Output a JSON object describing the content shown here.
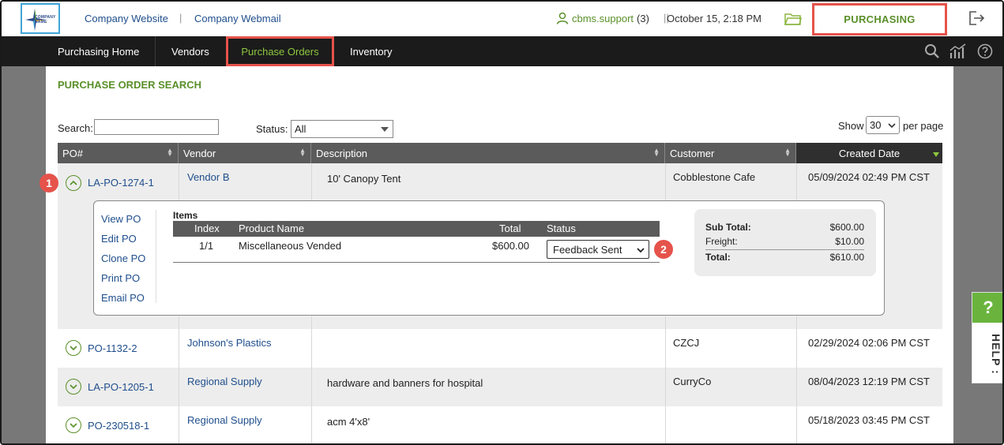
{
  "header": {
    "logo_text": "COMPANY NAME",
    "links": [
      "Company Website",
      "Company Webmail"
    ],
    "user": "cbms.support",
    "user_count": "(3)",
    "datetime": "October 15, 2:18 PM",
    "module": "PURCHASING"
  },
  "nav": {
    "items": [
      "Purchasing Home",
      "Vendors",
      "Purchase Orders",
      "Inventory"
    ],
    "active": "Purchase Orders"
  },
  "page": {
    "title": "PURCHASE ORDER SEARCH",
    "search_label": "Search:",
    "search_value": "",
    "status_label": "Status:",
    "status_value": "All",
    "show_label": "Show",
    "show_value": "30",
    "per_page_label": "per page"
  },
  "table": {
    "columns": [
      "PO#",
      "Vendor",
      "Description",
      "Customer",
      "Created Date"
    ],
    "rows": [
      {
        "po": "LA-PO-1274-1",
        "vendor": "Vendor B",
        "description": "10' Canopy Tent",
        "customer": "Cobblestone Cafe",
        "created": "05/09/2024 02:49 PM CST",
        "expanded": true
      },
      {
        "po": "PO-1132-2",
        "vendor": "Johnson's Plastics",
        "description": "",
        "customer": "CZCJ",
        "created": "02/29/2024 02:06 PM CST"
      },
      {
        "po": "LA-PO-1205-1",
        "vendor": "Regional Supply",
        "description": "hardware and banners for hospital",
        "customer": "CurryCo",
        "created": "08/04/2023 12:19 PM CST"
      },
      {
        "po": "PO-230518-1",
        "vendor": "Regional Supply",
        "description": "acm 4'x8'",
        "customer": "",
        "created": "05/18/2023 03:45 PM CST"
      }
    ]
  },
  "detail": {
    "actions": [
      "View PO",
      "Edit PO",
      "Clone PO",
      "Print PO",
      "Email PO"
    ],
    "items_title": "Items",
    "item_columns": [
      "Index",
      "Product Name",
      "Total",
      "Status"
    ],
    "items": [
      {
        "index": "1/1",
        "product": "Miscellaneous Vended",
        "total": "$600.00",
        "status": "Feedback Sent"
      }
    ],
    "summary": {
      "subtotal_label": "Sub Total:",
      "subtotal": "$600.00",
      "freight_label": "Freight:",
      "freight": "$10.00",
      "total_label": "Total:",
      "total": "$610.00"
    }
  },
  "callouts": [
    "1",
    "2"
  ],
  "help": {
    "q": "?",
    "label": "HELP :"
  },
  "colors": {
    "accent_green": "#5a8f2a",
    "nav_bg": "#1b1b1b",
    "highlight_red": "#e5534b",
    "link_blue": "#1f4e8c"
  }
}
